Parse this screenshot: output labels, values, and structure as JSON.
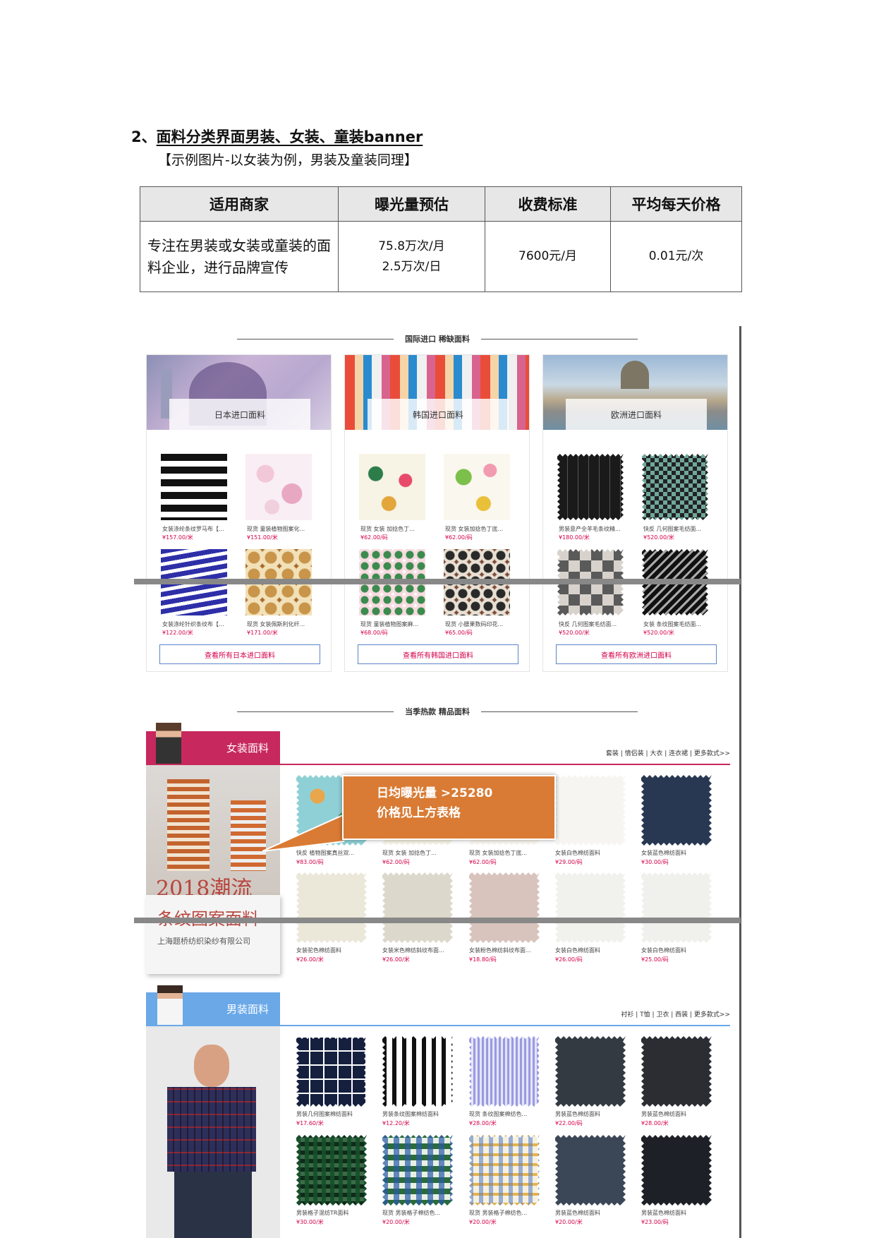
{
  "heading": {
    "number": "2、",
    "title": "面料分类界面男装、女装、童装banner"
  },
  "subheading": "【示例图片-以女装为例，男装及童装同理】",
  "price_table": {
    "headers": [
      "适用商家",
      "曝光量预估",
      "收费标准",
      "平均每天价格"
    ],
    "row": {
      "merchant": "专注在男装或女装或童装的面料企业，进行品牌宣传",
      "exposure_month": "75.8万次/月",
      "exposure_day": "2.5万次/日",
      "fee": "7600元/月",
      "daily_price": "0.01元/次"
    }
  },
  "import_section": {
    "title": "国际进口 稀缺面料",
    "cards": [
      {
        "banner": "日本进口面料",
        "button": "查看所有日本进口面料",
        "items": [
          {
            "name": "女装涤纶条纹罗马布【...",
            "price": "¥157.00/米"
          },
          {
            "name": "现货 童装植物图案化...",
            "price": "¥151.00/米"
          },
          {
            "name": "女装涤纶针织条纹布【...",
            "price": "¥122.00/米"
          },
          {
            "name": "现货 女装佩斯利化纤...",
            "price": "¥171.00/米"
          }
        ]
      },
      {
        "banner": "韩国进口面料",
        "button": "查看所有韩国进口面料",
        "items": [
          {
            "name": "现货 女装 加捻色丁...",
            "price": "¥62.00/码"
          },
          {
            "name": "现货 女装加捻色丁底...",
            "price": "¥62.00/码"
          },
          {
            "name": "现货 童装植物图案麻...",
            "price": "¥68.00/码"
          },
          {
            "name": "现货 小腰果数码印花...",
            "price": "¥65.00/码"
          }
        ]
      },
      {
        "banner": "欧洲进口面料",
        "button": "查看所有欧洲进口面料",
        "items": [
          {
            "name": "男装意产全羊毛条纹精...",
            "price": "¥180.00/米"
          },
          {
            "name": "快反 几何图案毛纺面...",
            "price": "¥520.00/米"
          },
          {
            "name": "快反 几何图案毛纺面...",
            "price": "¥520.00/米"
          },
          {
            "name": "女装 条纹图案毛纺面...",
            "price": "¥520.00/米"
          }
        ]
      }
    ]
  },
  "hot_section": {
    "title": "当季热款 精品面料"
  },
  "women": {
    "tab": "女装面料",
    "links": "套装 | 情侣装 | 大衣 | 连衣裙 | 更多款式>>",
    "watermark": "2018潮流",
    "promo": {
      "title": "条纹图案面料",
      "company": "上海题桥纺织染纱有限公司"
    },
    "callout": {
      "line1": "日均曝光量 >25280",
      "line2": "价格见上方表格"
    },
    "items": [
      {
        "name": "快反 植物图案真丝双...",
        "price": "¥83.00/码"
      },
      {
        "name": "现货 女装 加捻色丁...",
        "price": "¥62.00/码"
      },
      {
        "name": "现货 女装加捻色丁底...",
        "price": "¥62.00/码"
      },
      {
        "name": "女装白色棉纺面料",
        "price": "¥29.00/码"
      },
      {
        "name": "女装蓝色棉纺面料",
        "price": "¥30.00/码"
      },
      {
        "name": "女装驼色棉纺面料",
        "price": "¥26.00/米"
      },
      {
        "name": "女装米色棉纺斜纹布面...",
        "price": "¥26.00/米"
      },
      {
        "name": "女装粉色棉纺斜纹布面...",
        "price": "¥18.80/码"
      },
      {
        "name": "女装白色棉纺面料",
        "price": "¥26.00/码"
      },
      {
        "name": "女装白色棉纺面料",
        "price": "¥25.00/码"
      }
    ]
  },
  "men": {
    "tab": "男装面料",
    "links": "衬衫 | T恤 | 卫衣 | 西装 | 更多款式>>",
    "items": [
      {
        "name": "男装几何图案棉纺面料",
        "price": "¥17.60/米"
      },
      {
        "name": "男装条纹图案棉纺面料",
        "price": "¥12.20/米"
      },
      {
        "name": "现货 条纹图案棉纺色...",
        "price": "¥28.00/米"
      },
      {
        "name": "男装蓝色棉纺面料",
        "price": "¥22.00/码"
      },
      {
        "name": "男装蓝色棉纺面料",
        "price": "¥28.00/米"
      },
      {
        "name": "男装格子混纺TR面料",
        "price": "¥30.00/米"
      },
      {
        "name": "现货 男装格子棉纺色...",
        "price": "¥20.00/米"
      },
      {
        "name": "现货 男装格子棉纺色...",
        "price": "¥20.00/米"
      },
      {
        "name": "男装蓝色棉纺面料",
        "price": "¥20.00/米"
      },
      {
        "name": "男装蓝色棉纺面料",
        "price": "¥23.00/码"
      }
    ]
  }
}
